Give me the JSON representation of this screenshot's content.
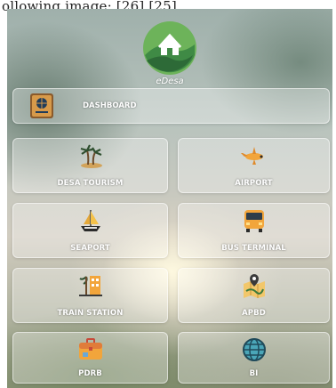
{
  "caption": "ollowing image: [26]  [25]",
  "app": {
    "name": "eDesa"
  },
  "menu": {
    "dashboard": "DASHBOARD",
    "tiles": [
      {
        "label": "DESA TOURISM",
        "icon": "palm-island-icon"
      },
      {
        "label": "AIRPORT",
        "icon": "airplane-icon"
      },
      {
        "label": "SEAPORT",
        "icon": "sailboat-icon"
      },
      {
        "label": "BUS TERMINAL",
        "icon": "bus-icon"
      },
      {
        "label": "TRAIN STATION",
        "icon": "train-station-icon"
      },
      {
        "label": "APBD",
        "icon": "map-location-icon"
      },
      {
        "label": "PDRB",
        "icon": "briefcase-icon"
      },
      {
        "label": "BI",
        "icon": "globe-icon"
      }
    ]
  },
  "colors": {
    "logo_green": "#4a9b4f",
    "logo_dark": "#2f6e3a",
    "accent_orange": "#f2a53b"
  }
}
